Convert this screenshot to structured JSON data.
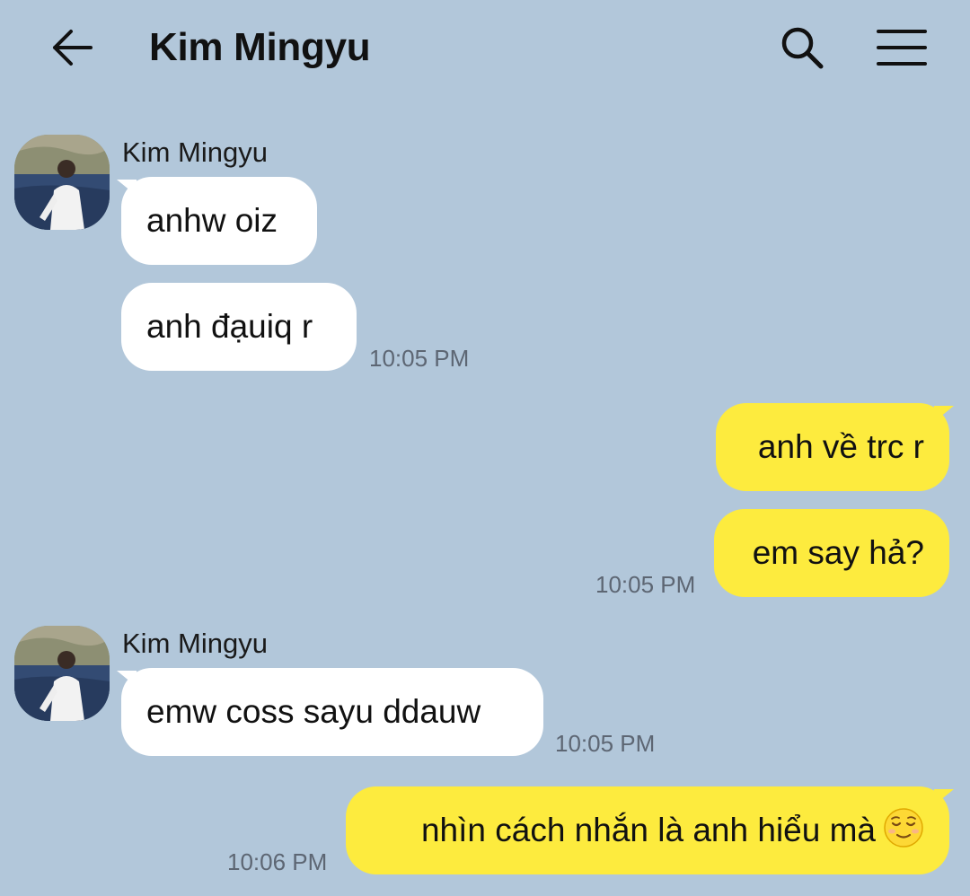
{
  "header": {
    "title": "Kim Mingyu",
    "back_icon": "arrow-left-icon",
    "search_icon": "search-icon",
    "menu_icon": "hamburger-menu-icon"
  },
  "colors": {
    "background": "#b2c7da",
    "incoming_bubble": "#ffffff",
    "outgoing_bubble": "#fdeb3e",
    "timestamp": "#5d6673"
  },
  "messages": [
    {
      "direction": "in",
      "sender": "Kim Mingyu",
      "text": "anhw oiz",
      "time": ""
    },
    {
      "direction": "in",
      "sender": "",
      "text": "anh đạuiq r",
      "time": "10:05 PM"
    },
    {
      "direction": "out",
      "text": "anh về trc r",
      "time": ""
    },
    {
      "direction": "out",
      "text": "em say hả?",
      "time": "10:05 PM"
    },
    {
      "direction": "in",
      "sender": "Kim Mingyu",
      "text": "emw coss sayu ddauw",
      "time": "10:05 PM"
    },
    {
      "direction": "out",
      "text": "nhìn cách nhắn là anh hiểu mà",
      "emoji": "relieved-face-emoji",
      "time": "10:06 PM"
    }
  ]
}
